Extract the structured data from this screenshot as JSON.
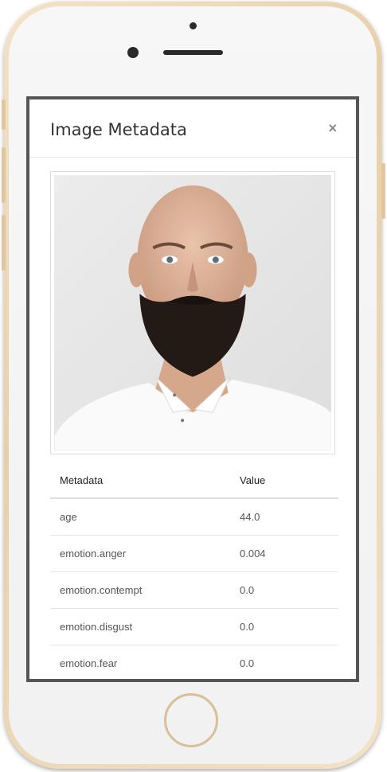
{
  "modal": {
    "title": "Image Metadata",
    "close_label": "×"
  },
  "photo": {
    "icon": "portrait-photo"
  },
  "table": {
    "headers": {
      "metadata": "Metadata",
      "value": "Value"
    },
    "rows": [
      {
        "key": "age",
        "value": "44.0"
      },
      {
        "key": "emotion.anger",
        "value": "0.004"
      },
      {
        "key": "emotion.contempt",
        "value": "0.0"
      },
      {
        "key": "emotion.disgust",
        "value": "0.0"
      },
      {
        "key": "emotion.fear",
        "value": "0.0"
      }
    ]
  },
  "colors": {
    "phone_frame": "#e8cfa8",
    "screen_border": "#555555",
    "title_text": "#333333"
  }
}
